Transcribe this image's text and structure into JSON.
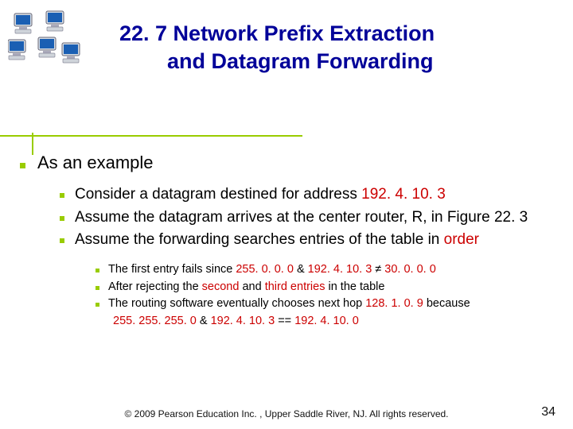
{
  "title_line1": "22. 7  Network Prefix Extraction",
  "title_line2": "and Datagram Forwarding",
  "l1": "As an example",
  "l2a": "Consider a datagram destined for address ",
  "l2a_red": "192. 4. 10. 3",
  "l2b": "Assume the datagram arrives at the center router, R, in Figure 22. 3",
  "l2c_a": "Assume the forwarding searches entries of the table in ",
  "l2c_red": "order",
  "l3a_a": "The first entry fails since  ",
  "l3a_b": "255. 0. 0. 0",
  "l3a_c": " & ",
  "l3a_d": "192. 4. 10. 3",
  "l3a_e": " ≠ ",
  "l3a_f": "30. 0. 0. 0",
  "l3b_a": "After rejecting the ",
  "l3b_b": "second",
  "l3b_c": " and ",
  "l3b_d": "third",
  "l3b_e": " entries",
  "l3b_f": " in the table",
  "l3c_a": "The routing software eventually chooses next hop ",
  "l3c_b": "128. 1. 0. 9",
  "l3c_c": " because",
  "l3d_a": "255. 255. 255. 0",
  "l3d_b": "  &  ",
  "l3d_c": "192. 4. 10. 3",
  "l3d_d": "  ==  ",
  "l3d_e": "192. 4. 10. 0",
  "footer": "© 2009 Pearson Education Inc. , Upper Saddle River, NJ. All rights reserved.",
  "pagenum": "34"
}
